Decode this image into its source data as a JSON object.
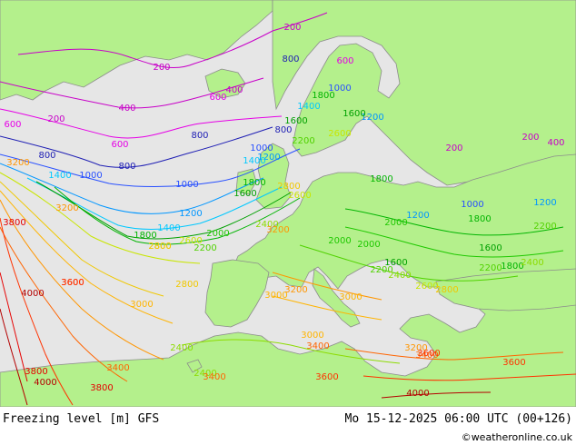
{
  "footer": {
    "title": "Freezing level [m] GFS",
    "datetime": "Mo 15-12-2025 06:00 UTC (00+126)",
    "credit": "©weatheronline.co.uk"
  },
  "map": {
    "colors": {
      "sea": "#e6e6e6",
      "land": "#b4f08c",
      "coast": "#8c8c8c"
    },
    "levels": [
      {
        "value": 200,
        "color": "#c800c8",
        "labels": [
          "200",
          "200",
          "200",
          "200",
          "200"
        ]
      },
      {
        "value": 400,
        "color": "#c800c8",
        "labels": [
          "400",
          "400",
          "400"
        ]
      },
      {
        "value": 600,
        "color": "#e600e6",
        "labels": [
          "600",
          "600",
          "600",
          "600"
        ]
      },
      {
        "value": 800,
        "color": "#1e1eb4",
        "labels": [
          "800",
          "800",
          "800",
          "800",
          "800"
        ]
      },
      {
        "value": 1000,
        "color": "#2850ff",
        "labels": [
          "1000",
          "1000",
          "1000",
          "1000",
          "1000"
        ]
      },
      {
        "value": 1200,
        "color": "#0096ff",
        "labels": [
          "1200",
          "1200",
          "1200",
          "1200",
          "1200"
        ]
      },
      {
        "value": 1400,
        "color": "#00c8ff",
        "labels": [
          "1400",
          "1400",
          "1400",
          "1400"
        ]
      },
      {
        "value": 1600,
        "color": "#00a000",
        "labels": [
          "1600",
          "1600",
          "1600",
          "1600",
          "1600"
        ]
      },
      {
        "value": 1800,
        "color": "#00b400",
        "labels": [
          "1800",
          "1800",
          "1800",
          "1800",
          "1800",
          "1800"
        ]
      },
      {
        "value": 2000,
        "color": "#1ec800",
        "labels": [
          "2000",
          "2000",
          "2000",
          "2000"
        ]
      },
      {
        "value": 2200,
        "color": "#50d200",
        "labels": [
          "2200",
          "2200",
          "2200",
          "2200",
          "2200"
        ]
      },
      {
        "value": 2400,
        "color": "#8cdc00",
        "labels": [
          "2400",
          "2400",
          "2400",
          "2400",
          "2400"
        ]
      },
      {
        "value": 2600,
        "color": "#c8e600",
        "labels": [
          "2600",
          "2600",
          "2600",
          "2600"
        ]
      },
      {
        "value": 2800,
        "color": "#f0c800",
        "labels": [
          "2800",
          "2800",
          "2800",
          "2800",
          "2800"
        ]
      },
      {
        "value": 3000,
        "color": "#ffb400",
        "labels": [
          "3000",
          "3000",
          "3000",
          "3000"
        ]
      },
      {
        "value": 3200,
        "color": "#ff9600",
        "labels": [
          "3200",
          "3200",
          "3200",
          "3200",
          "3200"
        ]
      },
      {
        "value": 3400,
        "color": "#ff6400",
        "labels": [
          "3400",
          "3400",
          "3400",
          "3400"
        ]
      },
      {
        "value": 3600,
        "color": "#ff3200",
        "labels": [
          "3600",
          "3600",
          "3600",
          "3600",
          "3600"
        ]
      },
      {
        "value": 3800,
        "color": "#e60000",
        "labels": [
          "3800",
          "3800",
          "3800"
        ]
      },
      {
        "value": 4000,
        "color": "#b40000",
        "labels": [
          "4000",
          "4000",
          "4000"
        ]
      }
    ]
  }
}
